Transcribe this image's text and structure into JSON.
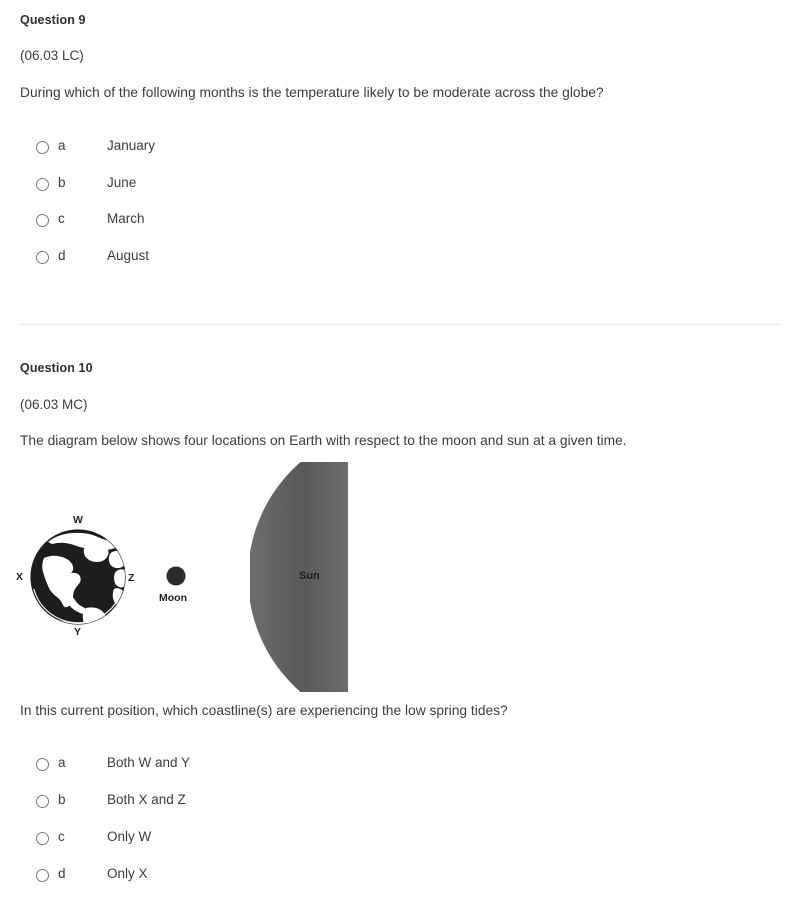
{
  "questions": [
    {
      "number": "Question 9",
      "code": "(06.03 LC)",
      "stem": "During which of the following months is the temperature likely to be moderate across the globe?",
      "options": [
        {
          "letter": "a",
          "text": "January"
        },
        {
          "letter": "b",
          "text": "June"
        },
        {
          "letter": "c",
          "text": "March"
        },
        {
          "letter": "d",
          "text": "August"
        }
      ]
    },
    {
      "number": "Question 10",
      "code": "(06.03 MC)",
      "stem": "The diagram below shows four locations on Earth with respect to the moon and sun at a given time.",
      "stem2": "In this current position, which coastline(s) are experiencing the low spring tides?",
      "options": [
        {
          "letter": "a",
          "text": "Both W and Y"
        },
        {
          "letter": "b",
          "text": "Both X and Z"
        },
        {
          "letter": "c",
          "text": "Only W"
        },
        {
          "letter": "d",
          "text": "Only X"
        }
      ]
    }
  ],
  "diagram": {
    "earth_labels": {
      "top": "W",
      "left": "X",
      "right": "Z",
      "bottom": "Y"
    },
    "moon_label": "Moon",
    "sun_label": "Sun",
    "colors": {
      "earth_ocean": "#1d1d1d",
      "earth_land": "#ffffff",
      "moon": "#2b2b2b",
      "sun_dark": "#5a5a5a",
      "sun_light": "#ffffff",
      "text": "#3c3c3c",
      "divider": "#e8e8e8",
      "radio_border": "#7a7a7a"
    }
  }
}
